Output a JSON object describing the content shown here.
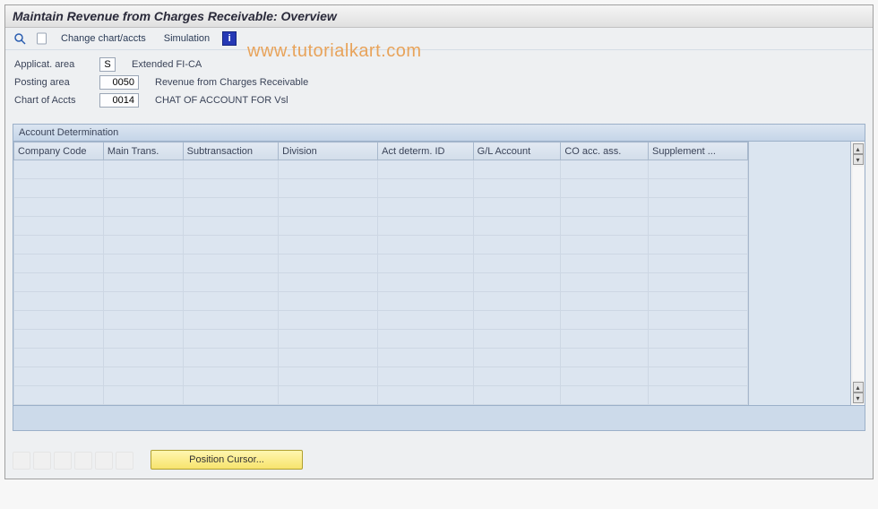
{
  "title": "Maintain Revenue from Charges Receivable: Overview",
  "toolbar": {
    "change_label": "Change chart/accts",
    "simulation_label": "Simulation"
  },
  "watermark": "www.tutorialkart.com",
  "header": {
    "applicat_area": {
      "label": "Applicat. area",
      "value": "S",
      "desc": "Extended FI-CA"
    },
    "posting_area": {
      "label": "Posting area",
      "value": "0050",
      "desc": "Revenue from Charges Receivable"
    },
    "chart_of_accts": {
      "label": "Chart of Accts",
      "value": "0014",
      "desc": "CHAT OF ACCOUNT FOR Vsl"
    }
  },
  "panel": {
    "title": "Account Determination",
    "columns": [
      "Company Code",
      "Main Trans.",
      "Subtransaction",
      "Division",
      "Act determ. ID",
      "G/L Account",
      "CO acc. ass.",
      "Supplement ..."
    ],
    "row_count": 13
  },
  "footer": {
    "position_cursor": "Position Cursor..."
  }
}
